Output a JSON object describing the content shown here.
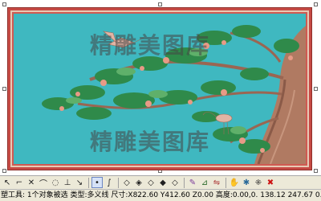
{
  "watermark": {
    "top_text": "精雕美图库",
    "bottom_text": "精雕美图库"
  },
  "colors": {
    "frame_red": "#c64a44",
    "panel_teal": "#3fb8c0",
    "branch_brown": "#b07a62",
    "needle_green": "#2f8a4a",
    "blossom_pink": "#e89a86"
  },
  "toolbar": {
    "tools": [
      {
        "name": "curve-tool-1-icon"
      },
      {
        "name": "curve-tool-2-icon"
      },
      {
        "name": "curve-tool-3-icon"
      },
      {
        "name": "curve-tool-4-icon"
      },
      {
        "name": "curve-tool-5-icon"
      },
      {
        "name": "curve-tool-6-icon"
      },
      {
        "name": "curve-tool-7-icon"
      },
      {
        "name": "node-tool-icon"
      },
      {
        "name": "select-node-icon"
      },
      {
        "name": "diamond-tool-1-icon"
      },
      {
        "name": "diamond-tool-2-icon"
      },
      {
        "name": "diamond-tool-3-icon"
      },
      {
        "name": "diamond-tool-4-icon"
      },
      {
        "name": "diamond-tool-5-icon"
      },
      {
        "name": "brush-tool-icon"
      },
      {
        "name": "measure-tool-icon"
      },
      {
        "name": "mirror-tool-icon"
      },
      {
        "name": "hand-tool-icon"
      },
      {
        "name": "star-tool-icon"
      },
      {
        "name": "delete-icon"
      }
    ]
  },
  "status": {
    "text": "塑工具: 1个对象被选 类型:多义线 尺寸:X822.60 Y412.60 Z0.00 高度:0.00,0. 138.12 247.67 0.00"
  }
}
